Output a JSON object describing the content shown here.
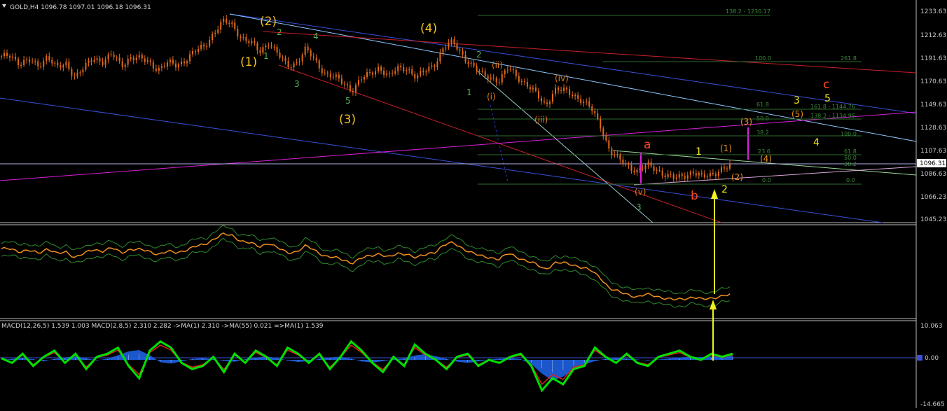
{
  "header": {
    "symbol_line": "GOLD,H4  1096.78 1097.01 1096.18 1096.31",
    "macd_line": "MACD(12,26,5) 1.539 1.003   MACD(2,8,5) 2.310 2.282   ->MA(1) 2.310   ->MA(55) 0.021   =>MA(1) 1.539"
  },
  "price_panel": {
    "y_ticks": [
      "1233.63",
      "1212.63",
      "1191.63",
      "1170.63",
      "1149.63",
      "1128.63",
      "1107.63",
      "1086.63",
      "1066.23",
      "1045.23"
    ],
    "current_price": "1096.31"
  },
  "macd_panel": {
    "y_ticks": [
      "10.063",
      "0.00",
      "-14.665"
    ]
  },
  "waves": {
    "major": [
      {
        "text": "(2)",
        "color": "#f2c01e"
      },
      {
        "text": "(1)",
        "color": "#f2c01e"
      },
      {
        "text": "(4)",
        "color": "#f2c01e"
      },
      {
        "text": "(3)",
        "color": "#f2c01e"
      }
    ],
    "minor_green": [
      {
        "text": "1"
      },
      {
        "text": "2"
      },
      {
        "text": "3"
      },
      {
        "text": "4"
      },
      {
        "text": "5"
      },
      {
        "text": "1"
      },
      {
        "text": "2"
      },
      {
        "text": "3"
      }
    ],
    "roman": [
      {
        "text": "(i)"
      },
      {
        "text": "(ii)"
      },
      {
        "text": "(iii)"
      },
      {
        "text": "(iv)"
      },
      {
        "text": "(v)"
      }
    ],
    "abc": [
      {
        "text": "a",
        "color": "#ff4a1e"
      },
      {
        "text": "b",
        "color": "#ff4a1e"
      },
      {
        "text": "c",
        "color": "#ff4a1e"
      }
    ],
    "projection": [
      {
        "text": "1",
        "color": "#f2e81e"
      },
      {
        "text": "2",
        "color": "#f2e81e"
      },
      {
        "text": "3",
        "color": "#f2e81e"
      },
      {
        "text": "4",
        "color": "#f2e81e"
      },
      {
        "text": "5",
        "color": "#f2e81e"
      },
      {
        "text": "(1)",
        "color": "#f09020"
      },
      {
        "text": "(2)",
        "color": "#f09020"
      },
      {
        "text": "(3)",
        "color": "#f09020"
      },
      {
        "text": "(4)",
        "color": "#f09020"
      },
      {
        "text": "(5)",
        "color": "#f09020"
      }
    ]
  },
  "fib_labels": [
    "138.2 - 1230.17",
    "100.0",
    "261.8",
    "61.8",
    "161.8 - 1144.76",
    "50.0",
    "138.2 - 1134.95",
    "38.2",
    "100.0",
    "23.6",
    "61.8",
    "50.0",
    "38.2",
    "0.0",
    "0.0"
  ],
  "chart_data": [
    {
      "type": "line",
      "title": "GOLD,H4",
      "ylim": [
        1045.23,
        1240
      ],
      "price_path": [
        1195,
        1198,
        1190,
        1192,
        1188,
        1197,
        1185,
        1190,
        1178,
        1186,
        1195,
        1192,
        1198,
        1188,
        1196,
        1194,
        1191,
        1185,
        1190,
        1188,
        1194,
        1201,
        1205,
        1218,
        1228,
        1225,
        1214,
        1209,
        1200,
        1210,
        1198,
        1187,
        1191,
        1203,
        1192,
        1182,
        1178,
        1172,
        1166,
        1176,
        1180,
        1187,
        1178,
        1185,
        1186,
        1177,
        1183,
        1190,
        1205,
        1209,
        1198,
        1188,
        1180,
        1178,
        1174,
        1186,
        1178,
        1170,
        1162,
        1152,
        1166,
        1165,
        1162,
        1156,
        1148,
        1133,
        1110,
        1102,
        1097,
        1092,
        1097,
        1094,
        1089,
        1085,
        1088,
        1092,
        1086,
        1089,
        1094,
        1096
      ],
      "colors": {
        "candles": "#e06a1c",
        "background": "#000000"
      },
      "grid": false
    },
    {
      "type": "line",
      "title": "MACD(12,26,5)",
      "ylim": [
        -14.665,
        10.063
      ],
      "series": [
        {
          "name": "MACD(2,8,5)",
          "color": "#00e000",
          "values": [
            0.5,
            -1,
            2,
            -2,
            1,
            3,
            -1,
            2,
            -3,
            1,
            2,
            4,
            -2,
            -6,
            3,
            6,
            4,
            -1,
            -3,
            -2,
            1,
            -4,
            2,
            -1,
            3,
            1,
            -2,
            4,
            2,
            -1,
            2,
            -3,
            1,
            6,
            3,
            -1,
            -4,
            1,
            -2,
            5,
            2,
            0,
            -3,
            1,
            2,
            -2,
            0,
            -1,
            1,
            2,
            -2,
            -10,
            -6,
            -8,
            -3,
            -2,
            4,
            1,
            -1,
            2,
            -1,
            -2,
            1,
            2,
            3,
            1,
            0,
            2,
            1,
            2
          ]
        },
        {
          "name": "MACD(12,26,5)",
          "color": "#1e5fe0",
          "values": [
            0,
            0.3,
            0.6,
            0.2,
            -0.4,
            0.3,
            0.8,
            1.2,
            0.5,
            -0.2,
            0.4,
            1.5,
            2.8,
            3.2,
            1.5,
            -0.8,
            -1.2,
            -0.5,
            0.3,
            0.6,
            0.2,
            -0.3,
            -0.6,
            0.2,
            0.7,
            1.1,
            0.6,
            -0.2,
            -0.7,
            -0.4,
            0.3,
            0.8,
            1.0,
            0.4,
            -0.5,
            -0.9,
            -0.4,
            0.2,
            0.5,
            1.4,
            1.9,
            1.2,
            0.3,
            -0.6,
            -1.0,
            -0.5,
            0.1,
            0.4,
            0.6,
            0.2,
            -1.4,
            -4.5,
            -6.8,
            -5.5,
            -3.2,
            -1.5,
            -0.4,
            0.3,
            0.6,
            0.4,
            0.1,
            -0.2,
            0.1,
            0.4,
            0.8,
            1.0,
            0.9,
            1.1,
            1.3,
            1.5
          ]
        }
      ]
    }
  ]
}
